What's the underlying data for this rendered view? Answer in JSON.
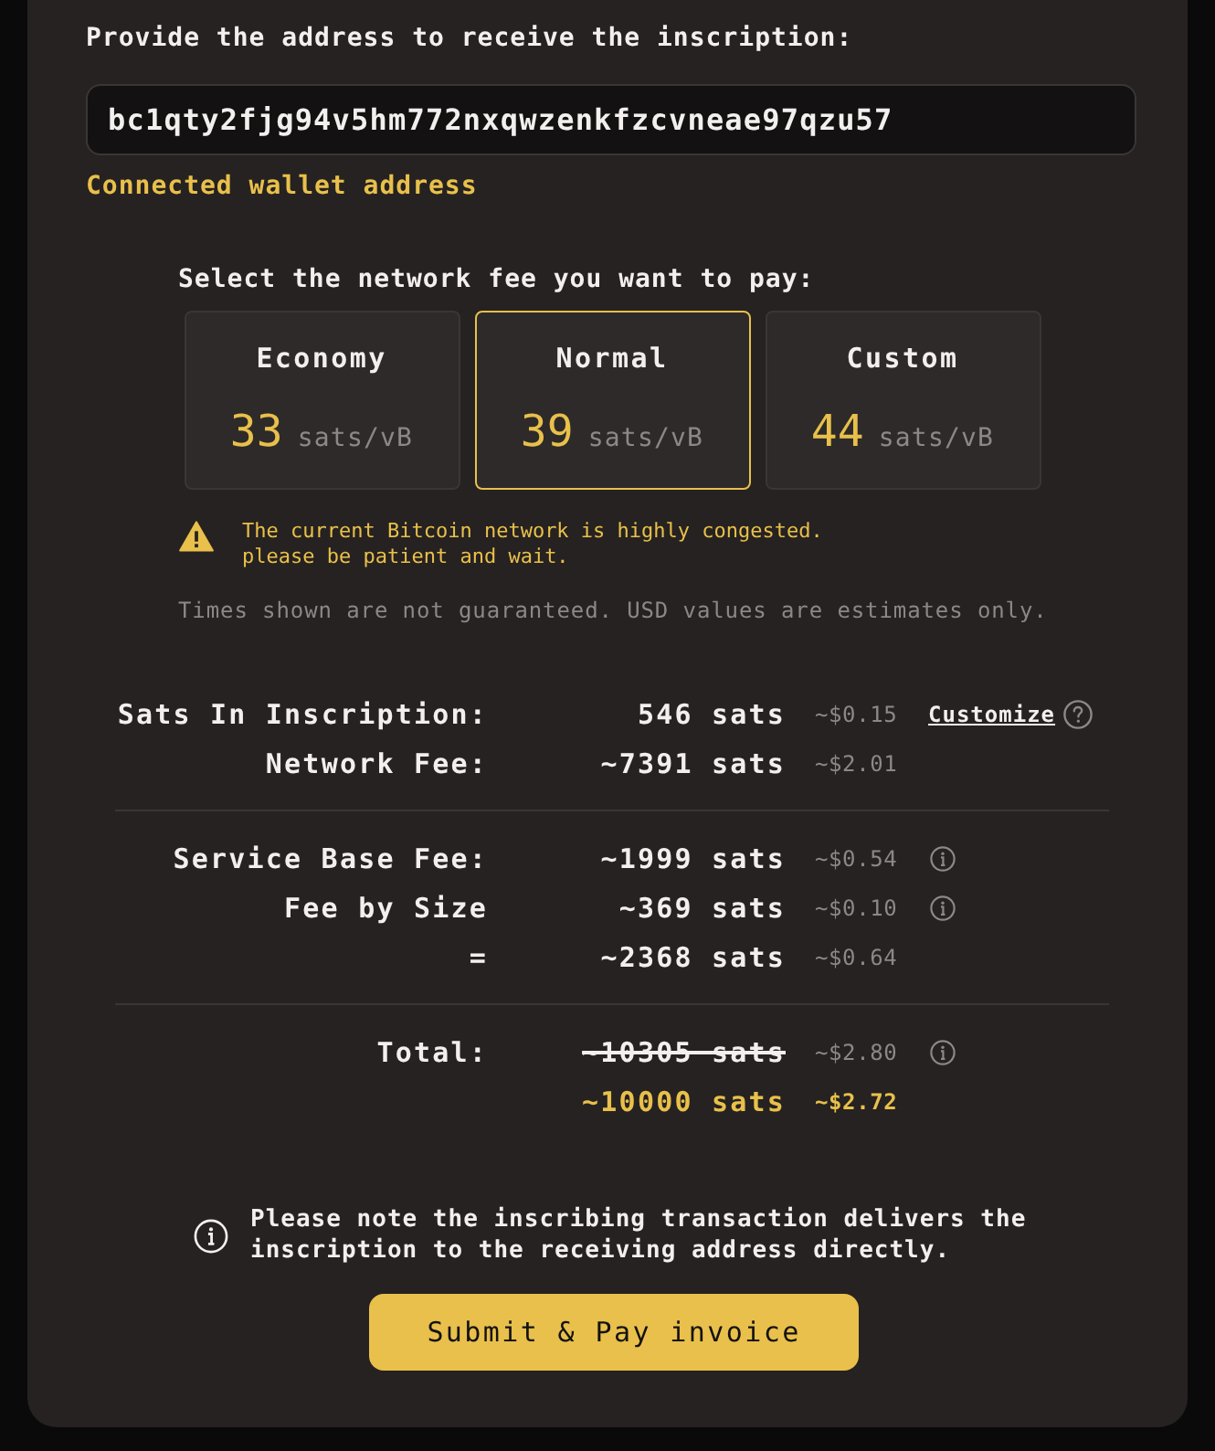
{
  "address_section": {
    "label": "Provide the address to receive the inscription:",
    "address_field": {
      "value": "bc1qty2fjg94v5hm772nxqwzenkfzcvneae97qzu57"
    },
    "hint": "Connected wallet address"
  },
  "fee_selector": {
    "label": "Select the network fee you want to pay:",
    "options": [
      {
        "name": "Economy",
        "rate": "33",
        "unit": "sats/vB",
        "selected": false
      },
      {
        "name": "Normal",
        "rate": "39",
        "unit": "sats/vB",
        "selected": true
      },
      {
        "name": "Custom",
        "rate": "44",
        "unit": "sats/vB",
        "selected": false
      }
    ],
    "warning": [
      "The current Bitcoin network is highly congested.",
      "please be patient and wait."
    ],
    "disclaimer": "Times shown are not guaranteed. USD values are estimates only."
  },
  "summary": {
    "groups": [
      {
        "rows": [
          {
            "label": "Sats In Inscription:",
            "amount": "546 sats",
            "usd": "~$0.15",
            "kind": "normal",
            "info": false,
            "link": "Customize"
          },
          {
            "label": "Network Fee:",
            "amount": "~7391 sats",
            "usd": "~$2.01",
            "kind": "normal",
            "info": false
          }
        ]
      },
      {
        "rows": [
          {
            "label": "Service Base Fee:",
            "amount": "~1999 sats",
            "usd": "~$0.54",
            "kind": "normal",
            "info": true
          },
          {
            "label": "Fee by Size",
            "amount": "~369 sats",
            "usd": "~$0.10",
            "kind": "normal",
            "info": true
          },
          {
            "label": "=",
            "amount": "~2368 sats",
            "usd": "~$0.64",
            "kind": "normal",
            "info": false
          }
        ]
      },
      {
        "rows": [
          {
            "label": "Total:",
            "amount": "~10305 sats",
            "usd": "~$2.80",
            "kind": "struck",
            "info": true
          },
          {
            "amount": "~10000 sats",
            "usd": "~$2.72",
            "kind": "discounted",
            "info": false
          }
        ]
      }
    ]
  },
  "note": {
    "text": "Please note the inscribing transaction delivers the inscription to the receiving address directly."
  },
  "submit_button": {
    "label": "Submit & Pay invoice"
  }
}
